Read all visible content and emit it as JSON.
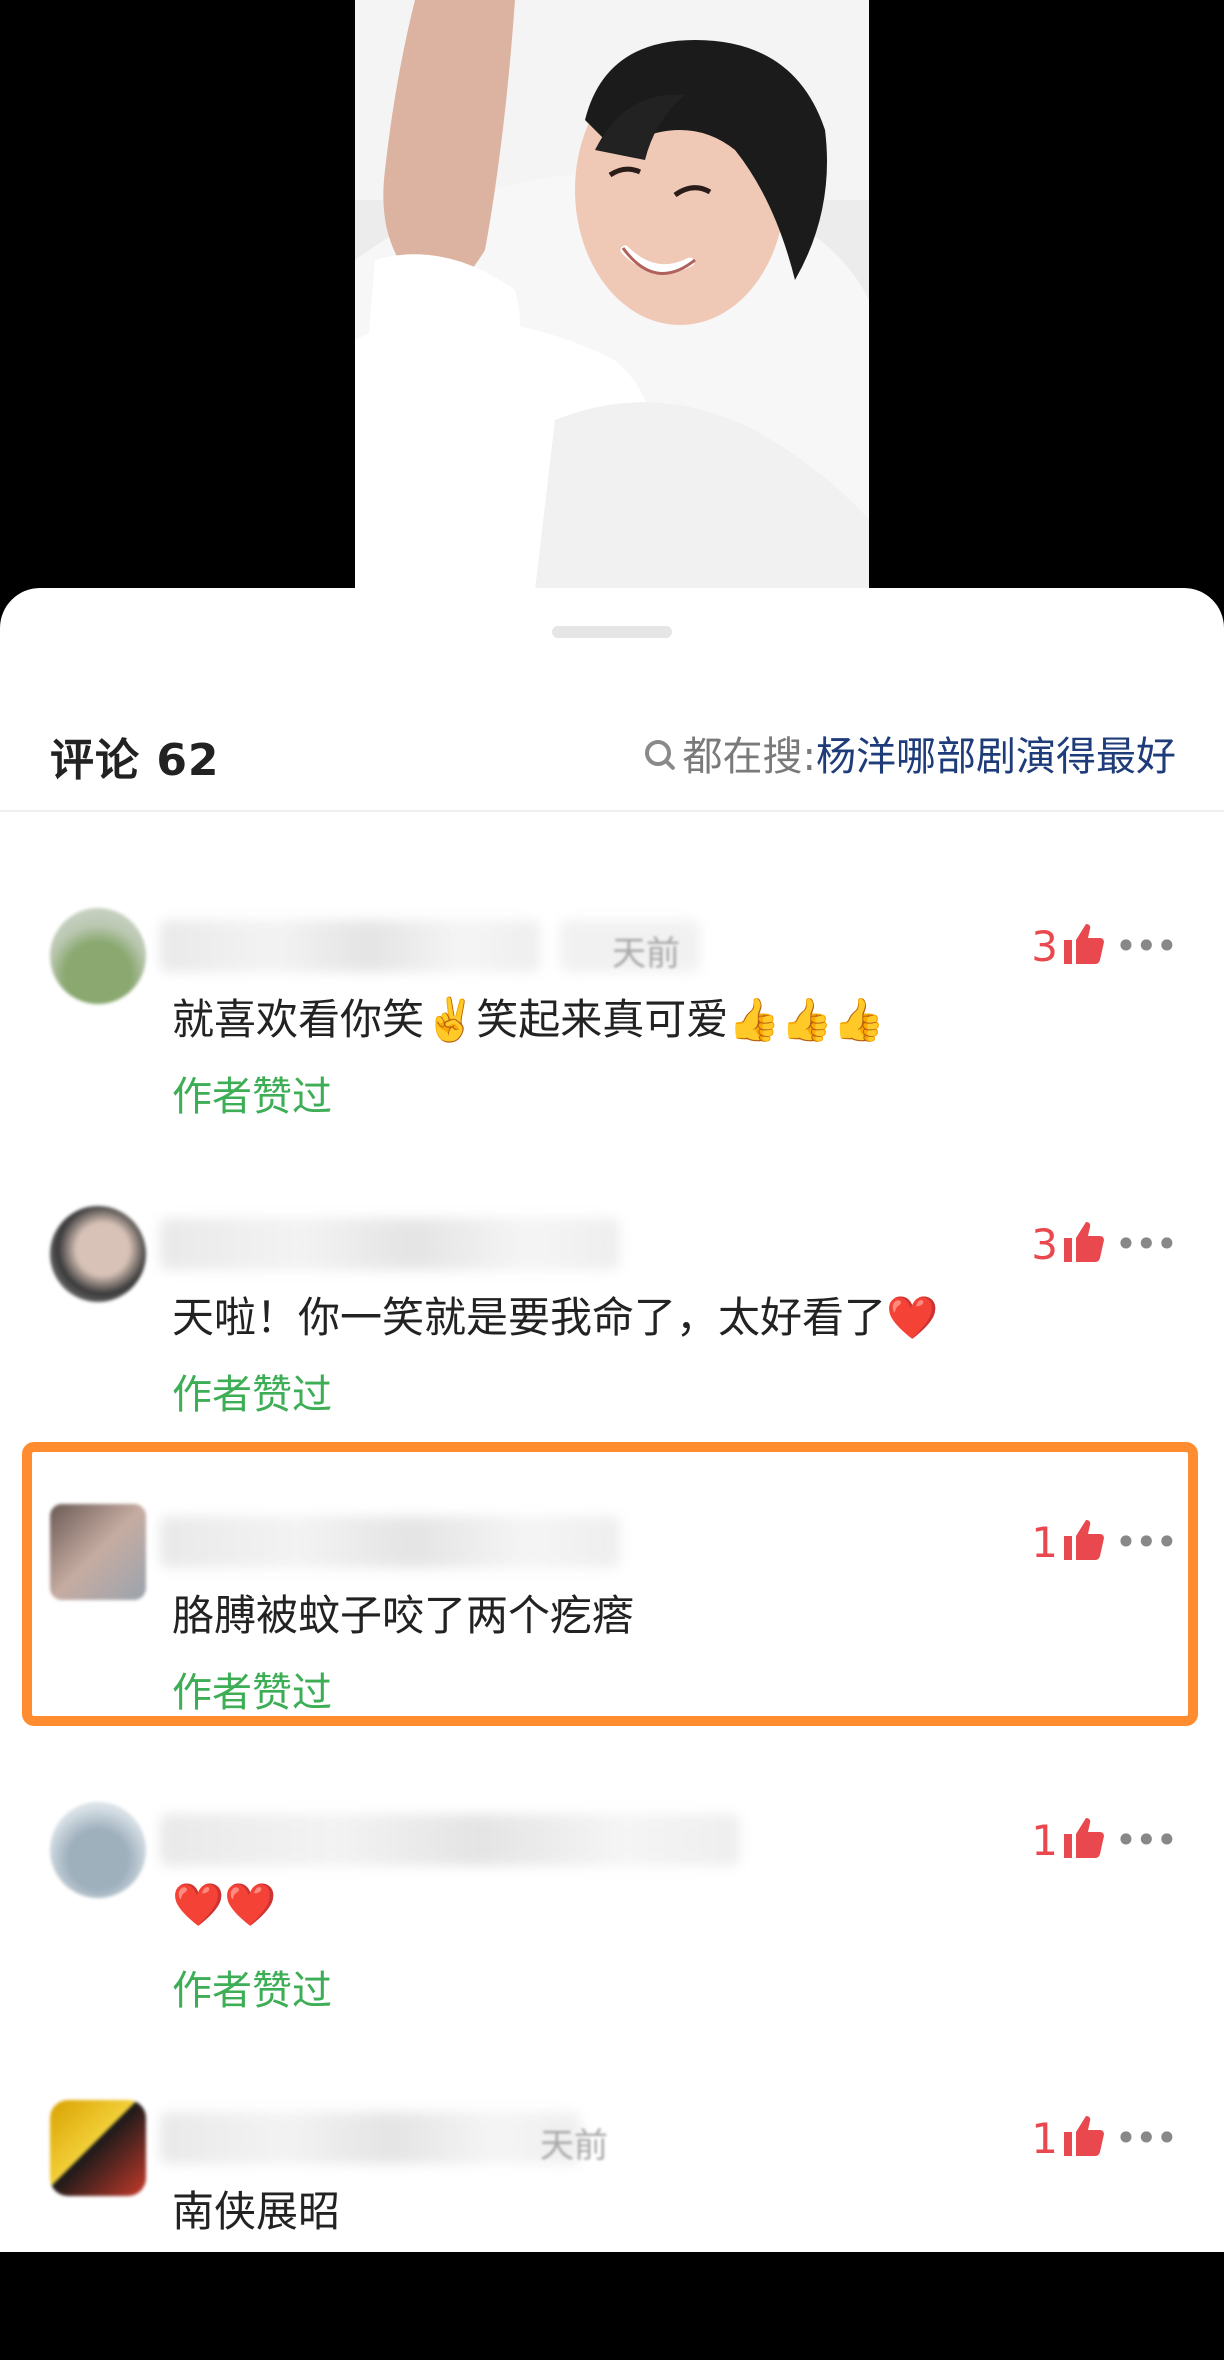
{
  "header": {
    "title": "评论 62",
    "search_prefix": "都在搜:",
    "search_query": "杨洋哪部剧演得最好"
  },
  "comments": [
    {
      "name_partial": "天前",
      "text": "就喜欢看你笑✌️笑起来真可爱👍👍👍",
      "likes": "3",
      "author_liked": "作者赞过"
    },
    {
      "name_partial": "",
      "text": "天啦！你一笑就是要我命了，太好看了❤️",
      "likes": "3",
      "author_liked": "作者赞过"
    },
    {
      "name_partial": "",
      "text": "胳膊被蚊子咬了两个疙瘩",
      "likes": "1",
      "author_liked": "作者赞过"
    },
    {
      "name_partial": "",
      "text": "❤️❤️",
      "likes": "1",
      "author_liked": "作者赞过"
    },
    {
      "name_partial": "天前",
      "text": "南侠展昭",
      "likes": "1",
      "author_liked": ""
    }
  ],
  "colors": {
    "like": "#e8484e",
    "author_liked": "#3dae55",
    "highlight": "#ff8c2f",
    "search_query": "#1f3c7a"
  },
  "icons": {
    "like": "thumbs-up-icon",
    "more": "more-icon",
    "search": "search-icon"
  }
}
